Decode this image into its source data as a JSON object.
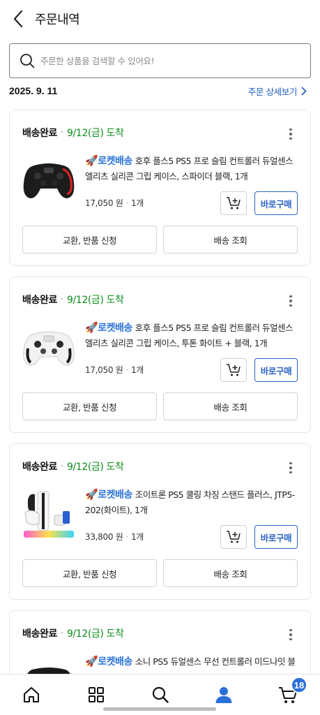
{
  "header": {
    "title": "주문내역"
  },
  "search": {
    "placeholder": "주문한 상품을 검색할 수 있어요!"
  },
  "order": {
    "date": "2025. 9. 11",
    "detail_label": "주문 상세보기"
  },
  "orders": [
    {
      "status": "배송완료",
      "eta": "9/12(금) 도착",
      "badge": "로켓배송",
      "name": "호후 플스5 PS5 프로 슬림 컨트롤러 듀얼센스 엘리츠 실리콘 그립 케이스, 스파이더 블랙, 1개",
      "price": "17,050 원",
      "qty": "1개",
      "buy_label": "바로구매",
      "return_label": "교환, 반품 신청",
      "track_label": "배송 조회"
    },
    {
      "status": "배송완료",
      "eta": "9/12(금) 도착",
      "badge": "로켓배송",
      "name": "호후 플스5 PS5 프로 슬림 컨트롤러 듀얼센스 엘리츠 실리콘 그립 케이스, 투톤 화이트 + 블랙, 1개",
      "price": "17,050 원",
      "qty": "1개",
      "buy_label": "바로구매",
      "return_label": "교환, 반품 신청",
      "track_label": "배송 조회"
    },
    {
      "status": "배송완료",
      "eta": "9/12(금) 도착",
      "badge": "로켓배송",
      "name": "조이트론 PS5 쿨링 차징 스탠드 플러스, JTP5-202(화이트), 1개",
      "price": "33,800 원",
      "qty": "1개",
      "buy_label": "바로구매",
      "return_label": "교환, 반품 신청",
      "track_label": "배송 조회"
    },
    {
      "status": "배송완료",
      "eta": "9/12(금) 도착",
      "badge": "로켓배송",
      "name": "소니 PS5 듀얼센스 무선 컨트롤러 미드나잇 블"
    }
  ],
  "nav": {
    "items": [
      "home-icon",
      "categories-icon",
      "search-icon",
      "my-account-icon",
      "cart-icon"
    ],
    "cart_count": "18"
  },
  "colors": {
    "accent": "#2a63c7",
    "eta_green": "#0a8c1a",
    "badge_blue": "#2a6fd8"
  }
}
